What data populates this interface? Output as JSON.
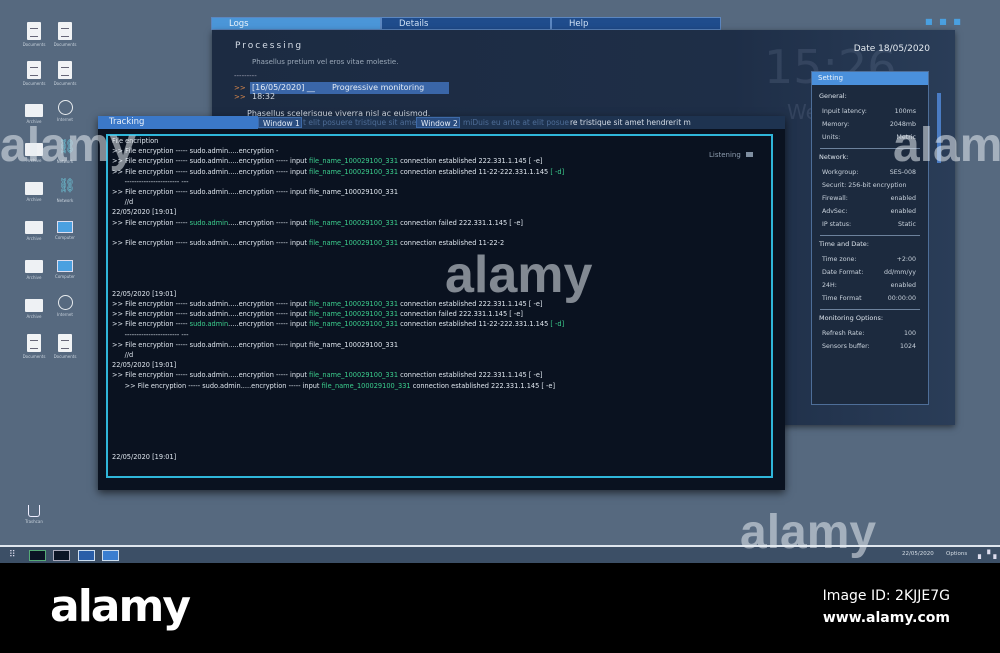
{
  "desktop": {
    "icons": [
      {
        "type": "doc",
        "label": "Documents"
      },
      {
        "type": "doc",
        "label": "Documents"
      },
      {
        "type": "doc",
        "label": "Documents"
      },
      {
        "type": "doc",
        "label": "Documents"
      },
      {
        "type": "fold",
        "label": "Archive"
      },
      {
        "type": "glob",
        "label": "Internet"
      },
      {
        "type": "fold",
        "label": "Archive"
      },
      {
        "type": "net",
        "label": "Network"
      },
      {
        "type": "fold",
        "label": "Archive"
      },
      {
        "type": "net",
        "label": "Network"
      },
      {
        "type": "fold",
        "label": "Archive"
      },
      {
        "type": "comp",
        "label": "Computer"
      },
      {
        "type": "fold",
        "label": "Archive"
      },
      {
        "type": "comp",
        "label": "Computer"
      },
      {
        "type": "fold",
        "label": "Archive"
      },
      {
        "type": "glob",
        "label": "Internet"
      },
      {
        "type": "doc",
        "label": "Documents"
      },
      {
        "type": "doc",
        "label": "Documents"
      }
    ],
    "trash_label": "Trashcan",
    "window_dots": "■ ■ ■"
  },
  "top_tabs": [
    "Logs",
    "Details",
    "Help"
  ],
  "processing": {
    "title": "Processing",
    "date": "Date 18/05/2020",
    "clock": "15:26",
    "day": "Wednesday",
    "line1": "Phasellus pretium vel eros vitae molestie.",
    "dashes": "---------",
    "arrow": ">>",
    "entry_date": "[16/05/2020]   __",
    "entry_title": "Progressive monitoring",
    "entry_time": "18:32",
    "line2": "Phasellus scelerisque viverra nisl ac euismod.",
    "line3": "re tristique sit amet hendrerit m",
    "listening": "Listening"
  },
  "tracking": {
    "title": "Tracking",
    "windows": [
      "Window 1",
      "Window 2"
    ],
    "ghost1": "t elit posuere tristique sit ame",
    "ghost2": "miDuis eu ante at elit posue",
    "log": [
      [
        {
          "t": "File encription"
        }
      ],
      [
        {
          "t": ">> File encryption ----- sudo.admin.....encryption -"
        }
      ],
      [
        {
          "t": ">> File encryption ----- sudo.admin.....encryption ----- input "
        },
        {
          "t": "file_name_100029100_331",
          "g": 1
        },
        {
          "t": " connection established 222.331.1.145 [ -e]"
        }
      ],
      [
        {
          "t": ">> File encryption ----- sudo.admin.....encryption ----- input "
        },
        {
          "t": "file_name_100029100_331",
          "g": 1
        },
        {
          "t": " connection established 11-22-222.331.1.145 "
        },
        {
          "t": "[ -d]",
          "g": 1
        }
      ],
      [
        {
          "t": "      ----------------------- ---"
        }
      ],
      [
        {
          "t": ">> File encryption ----- sudo.admin.....encryption ----- input file_name_100029100_331"
        }
      ],
      [
        {
          "t": "      //d"
        }
      ],
      [
        {
          "t": "22/05/2020 [19:01]"
        }
      ],
      [
        {
          "t": ">> File encryption ----- "
        },
        {
          "t": "sudo.admin",
          "g": 1
        },
        {
          "t": ".....encryption ----- input "
        },
        {
          "t": "file_name_100029100_331",
          "g": 1
        },
        {
          "t": " connection failed 222.331.1.145 [ -e]"
        }
      ],
      [],
      [
        {
          "t": ">> File encryption ----- sudo.admin.....encryption ----- input "
        },
        {
          "t": "file_name_100029100_331",
          "g": 1
        },
        {
          "t": " connection established 11-22-2"
        }
      ],
      [],
      [],
      [],
      [],
      [
        {
          "t": "22/05/2020 [19:01]"
        }
      ],
      [
        {
          "t": ">> File encryption ----- sudo.admin.....encryption ----- input "
        },
        {
          "t": "file_name_100029100_331",
          "g": 1
        },
        {
          "t": " connection established 222.331.1.145 [ -e]"
        }
      ],
      [
        {
          "t": ">> File encryption ----- sudo.admin.....encryption ----- input "
        },
        {
          "t": "file_name_100029100_331",
          "g": 1
        },
        {
          "t": " connection failed 222.331.1.145 [ -e]"
        }
      ],
      [
        {
          "t": ">> File encryption ----- "
        },
        {
          "t": "sudo.admin",
          "g": 1
        },
        {
          "t": ".....encryption ----- input "
        },
        {
          "t": "file_name_100029100_331",
          "g": 1
        },
        {
          "t": " connection established 11-22-222.331.1.145 "
        },
        {
          "t": "[ -d]",
          "g": 1
        }
      ],
      [
        {
          "t": "      ----------------------- ---"
        }
      ],
      [
        {
          "t": ">> File encryption ----- sudo.admin.....encryption ----- input file_name_100029100_331"
        }
      ],
      [
        {
          "t": "      //d"
        }
      ],
      [
        {
          "t": "22/05/2020 [19:01]"
        }
      ],
      [
        {
          "t": ">> File encryption ----- sudo.admin.....encryption ----- input "
        },
        {
          "t": "file_name_100029100_331",
          "g": 1
        },
        {
          "t": " connection established 222.331.1.145 [ -e]"
        }
      ],
      [
        {
          "t": "      >> File encryption ----- sudo.admin.....encryption ----- input "
        },
        {
          "t": "file_name_100029100_331",
          "g": 1
        },
        {
          "t": " connection established 222.331.1.145 [ -e]"
        }
      ],
      [],
      [],
      [],
      [],
      [],
      [],
      [
        {
          "t": "22/05/2020 [19:01]"
        }
      ]
    ]
  },
  "settings": {
    "title": "Setting",
    "sections": [
      {
        "name": "General:",
        "rows": [
          [
            "Inpuit latency:",
            "100ms"
          ],
          [
            "Memory:",
            "2048mb"
          ],
          [
            "Units:",
            "Metric"
          ]
        ]
      },
      {
        "name": "Network:",
        "rows": [
          [
            "Workgroup:",
            "SES-008"
          ],
          [
            "Securit: 256-bit encryption",
            ""
          ],
          [
            "Firewall:",
            "enabled"
          ],
          [
            "AdvSec:",
            "enabled"
          ],
          [
            "IP status:",
            "Static"
          ]
        ]
      },
      {
        "name": "Time and Date:",
        "rows": [
          [
            "Time zone:",
            "+2:00"
          ],
          [
            "Date Format:",
            "dd/mm/yy"
          ],
          [
            "24H:",
            "enabled"
          ],
          [
            "Time Format",
            "00:00:00"
          ]
        ]
      },
      {
        "name": "Monitoring Options:",
        "rows": [
          [
            "Refresh Rate:",
            "100"
          ],
          [
            "Sensors buffer:",
            "1024"
          ]
        ]
      }
    ]
  },
  "taskbar": {
    "date": "22/05/2020",
    "options": "Options"
  },
  "watermark": {
    "brand": "alamy",
    "image_id": "Image ID: 2KJJE7G",
    "url": "www.alamy.com"
  }
}
